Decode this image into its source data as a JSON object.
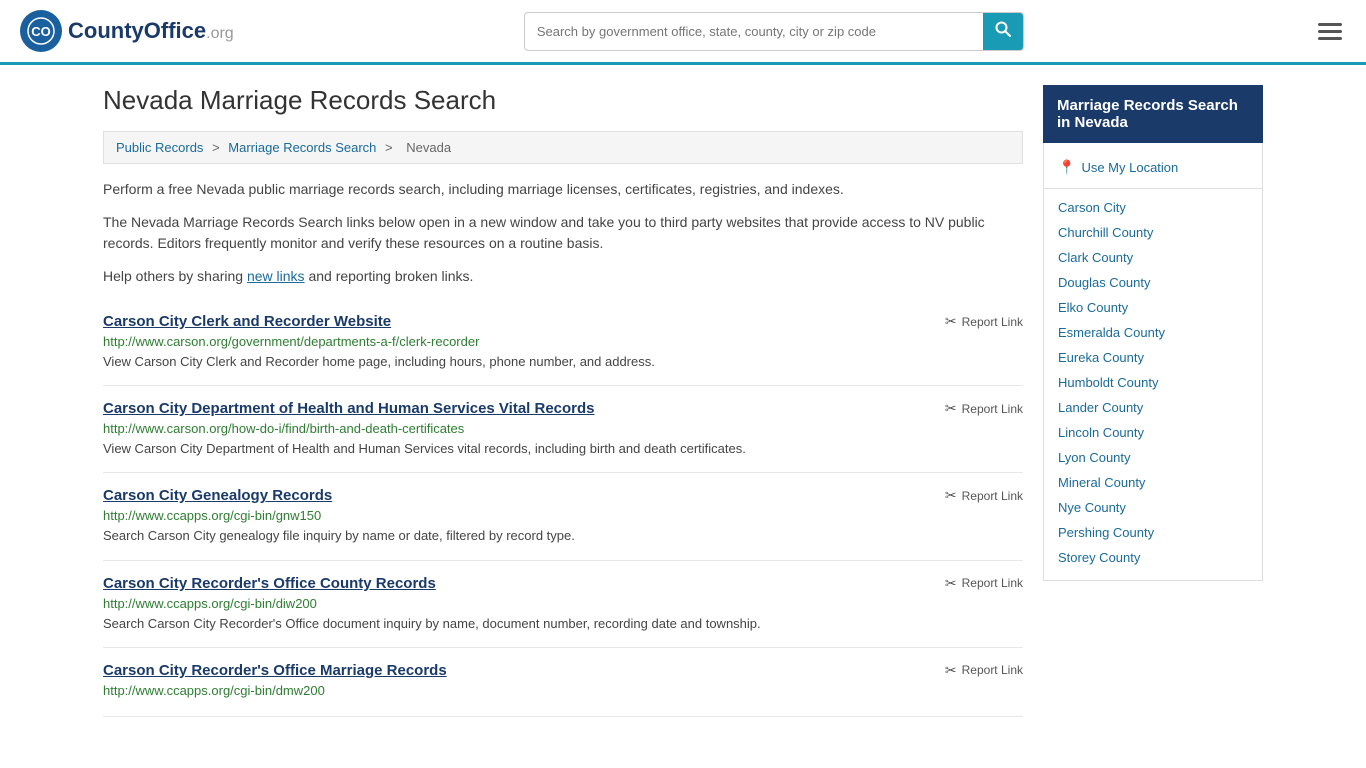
{
  "header": {
    "logo_text": "CountyOffice",
    "logo_suffix": ".org",
    "search_placeholder": "Search by government office, state, county, city or zip code",
    "search_button_label": "🔍"
  },
  "page": {
    "title": "Nevada Marriage Records Search",
    "breadcrumbs": [
      {
        "label": "Public Records",
        "href": "#"
      },
      {
        "label": "Marriage Records Search",
        "href": "#"
      },
      {
        "label": "Nevada",
        "href": "#"
      }
    ],
    "description1": "Perform a free Nevada public marriage records search, including marriage licenses, certificates, registries, and indexes.",
    "description2": "The Nevada Marriage Records Search links below open in a new window and take you to third party websites that provide access to NV public records. Editors frequently monitor and verify these resources on a routine basis.",
    "description3_pre": "Help others by sharing ",
    "description3_link": "new links",
    "description3_post": " and reporting broken links."
  },
  "records": [
    {
      "title": "Carson City Clerk and Recorder Website",
      "url": "http://www.carson.org/government/departments-a-f/clerk-recorder",
      "description": "View Carson City Clerk and Recorder home page, including hours, phone number, and address."
    },
    {
      "title": "Carson City Department of Health and Human Services Vital Records",
      "url": "http://www.carson.org/how-do-i/find/birth-and-death-certificates",
      "description": "View Carson City Department of Health and Human Services vital records, including birth and death certificates."
    },
    {
      "title": "Carson City Genealogy Records",
      "url": "http://www.ccapps.org/cgi-bin/gnw150",
      "description": "Search Carson City genealogy file inquiry by name or date, filtered by record type."
    },
    {
      "title": "Carson City Recorder's Office County Records",
      "url": "http://www.ccapps.org/cgi-bin/diw200",
      "description": "Search Carson City Recorder's Office document inquiry by name, document number, recording date and township."
    },
    {
      "title": "Carson City Recorder's Office Marriage Records",
      "url": "http://www.ccapps.org/cgi-bin/dmw200",
      "description": ""
    }
  ],
  "report_label": "Report Link",
  "sidebar": {
    "header": "Marriage Records Search in Nevada",
    "use_my_location": "Use My Location",
    "counties": [
      "Carson City",
      "Churchill County",
      "Clark County",
      "Douglas County",
      "Elko County",
      "Esmeralda County",
      "Eureka County",
      "Humboldt County",
      "Lander County",
      "Lincoln County",
      "Lyon County",
      "Mineral County",
      "Nye County",
      "Pershing County",
      "Storey County"
    ]
  }
}
